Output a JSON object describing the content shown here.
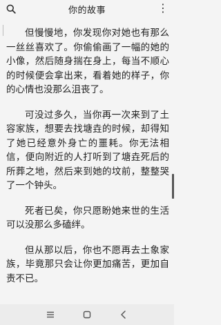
{
  "header": {
    "title": "你的故事",
    "search_icon": "search-icon",
    "menu_icon": "more-vertical-icon",
    "menu_glyph": "⋮"
  },
  "reader": {
    "paragraphs": [
      "但慢慢地，你发现你对她也有那么一丝丝喜欢了。你偷偷画了一幅的她的小像，然后随身揣在身上，每当不顺心的时候便会拿出来，看着她的样子，你的心情也没那么沮丧了。",
      "可没过多久，当你再一次来到了土容家族，想要去找塘垚的时候，却得知了她已经意外身亡的噩耗。你无法相信，便向附近的人打听到了塘垚死后的所葬之地，然后来到她的坟前，整整哭了一个钟头。",
      "死者已矣，你只愿盼她来世的生活可以没那么多磕绊。",
      "但从那以后，你也不愿再去土象家族，毕竟那只会让你更加痛苦，更加自责不已。"
    ]
  },
  "nav": {
    "menu_icon": "nav-menu-icon",
    "home_icon": "nav-home-icon",
    "back_icon": "nav-back-icon"
  },
  "colors": {
    "background": "#f4f4f4",
    "text": "#222222",
    "nav_background": "#ececec"
  }
}
